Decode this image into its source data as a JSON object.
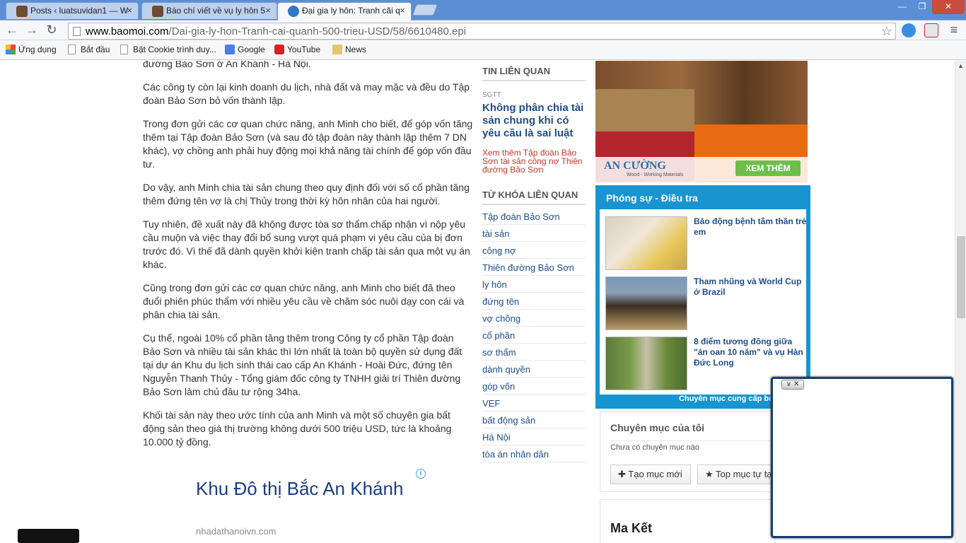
{
  "browser": {
    "tabs": [
      {
        "title": "Posts ‹ luatsuvidan1 — W",
        "close": "×"
      },
      {
        "title": "Báo chí viết về vụ ly hôn 5",
        "close": "×"
      },
      {
        "title": "Đại gia ly hôn: Tranh cãi q",
        "close": "×"
      }
    ],
    "window_buttons": {
      "minimize": "—",
      "maximize": "❐",
      "close": "✕"
    },
    "nav": {
      "back": "←",
      "forward": "→",
      "reload": "↻",
      "menu": "≡",
      "star": "☆"
    },
    "url": {
      "host": "www.baomoi.com",
      "path": "/Dai-gia-ly-hon-Tranh-cai-quanh-500-trieu-USD/58/6610480.epi"
    },
    "bookmarks": [
      {
        "label": "Ứng dụng",
        "icon": "apps-grid-icon"
      },
      {
        "label": "Bắt đầu",
        "icon": "page-icon"
      },
      {
        "label": "Bật Cookie trình duy...",
        "icon": "page-icon"
      },
      {
        "label": "Google",
        "icon": "google-icon"
      },
      {
        "label": "YouTube",
        "icon": "youtube-icon"
      },
      {
        "label": "News",
        "icon": "folder-icon"
      }
    ]
  },
  "article": {
    "paragraphs": [
      "đường Bảo Sơn ở An Khánh - Hà Nội.",
      "Các công ty còn lại kinh doanh du lịch, nhà đất và may mặc và đều do Tập đoàn Bảo Sơn bỏ vốn thành lập.",
      "Trong đơn gửi các cơ quan chức năng, anh Minh cho biết, để góp vốn tăng thêm tại Tập đoàn Bảo Sơn (và sau đó tập đoàn này thành lập thêm 7 DN khác), vợ chồng anh phải huy động mọi khả năng tài chính để góp vốn đầu tư.",
      "Do vậy, anh Minh chia tài sản chung theo quy định đối với số cổ phần tăng thêm đứng tên vợ là chị Thủy trong thời kỳ hôn nhân của hai người.",
      "Tuy nhiên, đề xuất này đã không được tòa sơ thẩm chấp nhận vì nộp yêu cầu muộn và việc thay đổi bổ sung vượt quá phạm vi yêu cầu của bị đơn trước đó. Vì thế đã dành quyền khởi kiện tranh chấp tài sản qua một vụ án khác.",
      "Cũng trong đơn gửi các cơ quan chức năng, anh Minh cho biết đã theo đuổi phiên phúc thẩm với nhiều yêu cầu về chăm sóc nuôi dạy con cái và phân chia tài sản.",
      "Cụ thể, ngoài 10% cổ phần tăng thêm trong Công ty cổ phần Tập đoàn Bảo Sơn và nhiều tài sản khác thì lớn nhất là toàn bộ quyền sử dụng đất tại dự án Khu du lịch sinh thái cao cấp An Khánh - Hoài Đức, đứng tên Nguyễn Thanh Thủy - Tổng giám đốc công ty TNHH giải trí Thiên đường Bảo Sơn làm chủ đầu tư rộng 34ha.",
      "Khối tài sản này theo ước tính của anh Minh và một số chuyên gia bất động sản theo giá thị trường không dưới 500 triệu USD, tức là khoảng 10.000 tỷ đồng."
    ]
  },
  "ad": {
    "title": "Khu Đô thị Bắc An Khánh",
    "url": "nhadathanoivn.com",
    "info": "i"
  },
  "related": {
    "heading": "TIN LIÊN QUAN",
    "source": "SGTT",
    "title": "Không phân chia tài sản chung khi có yêu cầu là sai luật",
    "more": "Xem thêm Tập đoàn Bảo Sơn tài sản công nợ Thiên đường Bảo Sơn"
  },
  "keywords": {
    "heading": "TỪ KHÓA LIÊN QUAN",
    "items": [
      "Tập đoàn Bảo Sơn",
      "tài sản",
      "công nợ",
      "Thiên đường Bảo Sơn",
      "ly hôn",
      "đứng tên",
      "vợ chồng",
      "cổ phần",
      "sơ thẩm",
      "dành quyền",
      "góp vốn",
      "VEF",
      "bất động sản",
      "Hà Nội",
      "tòa án nhân dân"
    ]
  },
  "banner": {
    "brand": "AN CƯỜNG",
    "sub": "Wood - Working Materials",
    "cta": "XEM THÊM"
  },
  "report": {
    "heading": "Phóng sự - Điều tra",
    "items": [
      {
        "title": "Báo động bệnh tâm thần trẻ em"
      },
      {
        "title": "Tham nhũng và World Cup ở Brazil"
      },
      {
        "title": "8 điểm tương đồng giữa \"án oan 10 năm\" và vụ Hàn Đức Long"
      }
    ],
    "footer": "Chuyên mục cung cấp bởi"
  },
  "my_channel": {
    "heading": "Chuyên mục của tôi",
    "empty": "Chưa có chuyên mục nào",
    "add_button": "Tạo mục mới",
    "custom_button": "Top mục tự tạo"
  },
  "maket": {
    "heading": "Ma Kết"
  },
  "popup": {
    "controls": "∨ ✕"
  },
  "colors": {
    "tabbar": "#5b8ed4",
    "link": "#1e4d89",
    "report_bg": "#1895d0",
    "related_more": "#c0392b",
    "popup_border": "#1a3f6e"
  }
}
